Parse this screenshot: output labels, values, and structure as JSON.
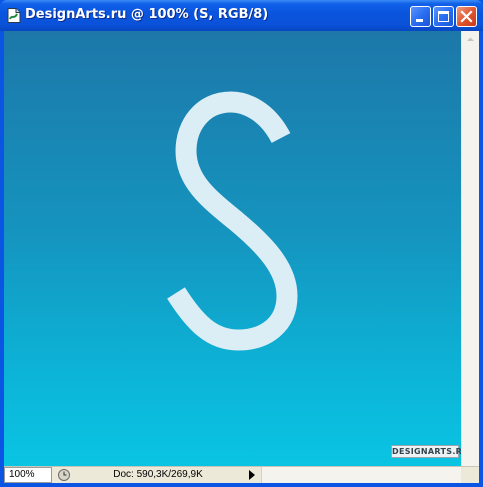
{
  "window": {
    "title": "DesignArts.ru @ 100% (S, RGB/8)",
    "accent_color": "#0a55e3",
    "controls": [
      "minimize-icon",
      "maximize-icon",
      "close-icon"
    ]
  },
  "canvas": {
    "letter": "S",
    "letter_color": "#dceef5",
    "gradient_top": "#1d78a9",
    "gradient_bottom": "#0ac4e3",
    "watermark": "DESIGNARTS.RU"
  },
  "statusbar": {
    "zoom": "100%",
    "doc_info": "Doc: 590,3K/269,9K"
  }
}
